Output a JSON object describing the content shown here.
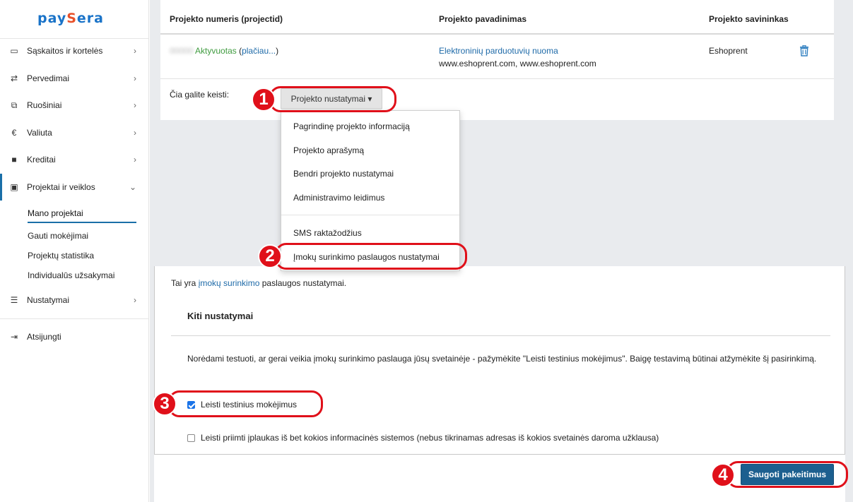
{
  "brand": {
    "logo_left": "pay",
    "logo_accent": "S",
    "logo_right": "era"
  },
  "sidebar": {
    "items": [
      {
        "label": "Sąskaitos ir kortelės",
        "icon": "card-icon",
        "glyph": "▭"
      },
      {
        "label": "Pervedimai",
        "icon": "transfer-icon",
        "glyph": "⇄"
      },
      {
        "label": "Ruošiniai",
        "icon": "copy-icon",
        "glyph": "⧉"
      },
      {
        "label": "Valiuta",
        "icon": "euro-icon",
        "glyph": "€"
      },
      {
        "label": "Kreditai",
        "icon": "briefcase-icon",
        "glyph": "■"
      },
      {
        "label": "Projektai ir veiklos",
        "icon": "clipboard-icon",
        "glyph": "▣"
      }
    ],
    "subitems": [
      "Mano projektai",
      "Gauti mokėjimai",
      "Projektų statistika",
      "Individualūs užsakymai"
    ],
    "settings": {
      "label": "Nustatymai",
      "glyph": "☰"
    },
    "logout": {
      "label": "Atsijungti",
      "glyph": "⇥"
    }
  },
  "table": {
    "headers": [
      "Projekto numeris (projectid)",
      "Projekto pavadinimas",
      "Projekto savininkas"
    ],
    "row": {
      "project_id": "00000",
      "status": "Aktyvuotas",
      "more_open": "(",
      "more_link": "plačiau...",
      "more_close": ")",
      "name": "Elektroninių parduotuvių nuoma",
      "urls": "www.eshoprent.com, www.eshoprent.com",
      "owner": "Eshoprent"
    },
    "change_label": "Čia galite keisti:",
    "dropdown_button": "Projekto nustatymai ▾"
  },
  "dropdown_menu": {
    "items": [
      "Pagrindinę projekto informaciją",
      "Projekto aprašymą",
      "Bendri projekto nustatymai",
      "Administravimo leidimus",
      "SMS raktažodžius",
      "Įmokų surinkimo paslaugos nustatymai"
    ]
  },
  "settings_panel": {
    "intro_before": "Tai yra ",
    "intro_link": "įmokų surinkimo",
    "intro_after": " paslaugos nustatymai.",
    "section_title": "Kiti nustatymai",
    "description": "Norėdami testuoti, ar gerai veikia įmokų surinkimo paslauga jūsų svetainėje - pažymėkite \"Leisti testinius mokėjimus\". Baigę testavimą būtinai atžymėkite šį pasirinkimą.",
    "checkbox_test": {
      "label": "Leisti testinius mokėjimus",
      "checked": true
    },
    "checkbox_any_system": {
      "label": "Leisti priimti įplaukas iš bet kokios informacinės sistemos (nebus tikrinamas adresas iš kokios svetainės daroma užklausa)",
      "checked": false
    },
    "save_button": "Saugoti pakeitimus"
  },
  "annotations": {
    "n1": "1",
    "n2": "2",
    "n3": "3",
    "n4": "4",
    "color": "#e0101a"
  }
}
